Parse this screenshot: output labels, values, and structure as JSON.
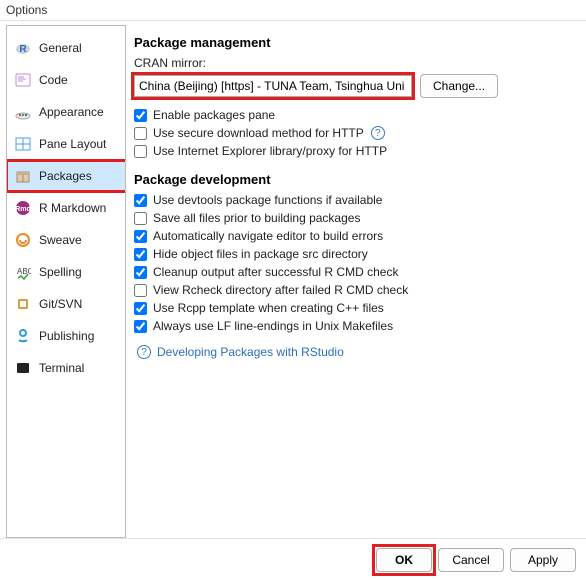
{
  "window_title": "Options",
  "sidebar": {
    "items": [
      {
        "label": "General",
        "icon": "r-logo-icon"
      },
      {
        "label": "Code",
        "icon": "code-icon"
      },
      {
        "label": "Appearance",
        "icon": "palette-icon"
      },
      {
        "label": "Pane Layout",
        "icon": "panes-icon"
      },
      {
        "label": "Packages",
        "icon": "package-icon",
        "selected": true,
        "highlight": true
      },
      {
        "label": "R Markdown",
        "icon": "rmd-icon"
      },
      {
        "label": "Sweave",
        "icon": "sweave-icon"
      },
      {
        "label": "Spelling",
        "icon": "spelling-icon"
      },
      {
        "label": "Git/SVN",
        "icon": "git-icon"
      },
      {
        "label": "Publishing",
        "icon": "publish-icon"
      },
      {
        "label": "Terminal",
        "icon": "terminal-icon"
      }
    ]
  },
  "management": {
    "heading": "Package management",
    "mirror_label": "CRAN mirror:",
    "mirror_value": "China (Beijing) [https] - TUNA Team, Tsinghua Uni",
    "change_button": "Change...",
    "checks": [
      {
        "label": "Enable packages pane",
        "checked": true
      },
      {
        "label": "Use secure download method for HTTP",
        "checked": false,
        "help": true
      },
      {
        "label": "Use Internet Explorer library/proxy for HTTP",
        "checked": false
      }
    ]
  },
  "development": {
    "heading": "Package development",
    "checks": [
      {
        "label": "Use devtools package functions if available",
        "checked": true
      },
      {
        "label": "Save all files prior to building packages",
        "checked": false
      },
      {
        "label": "Automatically navigate editor to build errors",
        "checked": true
      },
      {
        "label": "Hide object files in package src directory",
        "checked": true
      },
      {
        "label": "Cleanup output after successful R CMD check",
        "checked": true
      },
      {
        "label": "View Rcheck directory after failed R CMD check",
        "checked": false
      },
      {
        "label": "Use Rcpp template when creating C++ files",
        "checked": true
      },
      {
        "label": "Always use LF line-endings in Unix Makefiles",
        "checked": true
      }
    ],
    "link_label": "Developing Packages with RStudio"
  },
  "buttons": {
    "ok": "OK",
    "cancel": "Cancel",
    "apply": "Apply"
  },
  "help_glyph": "?"
}
